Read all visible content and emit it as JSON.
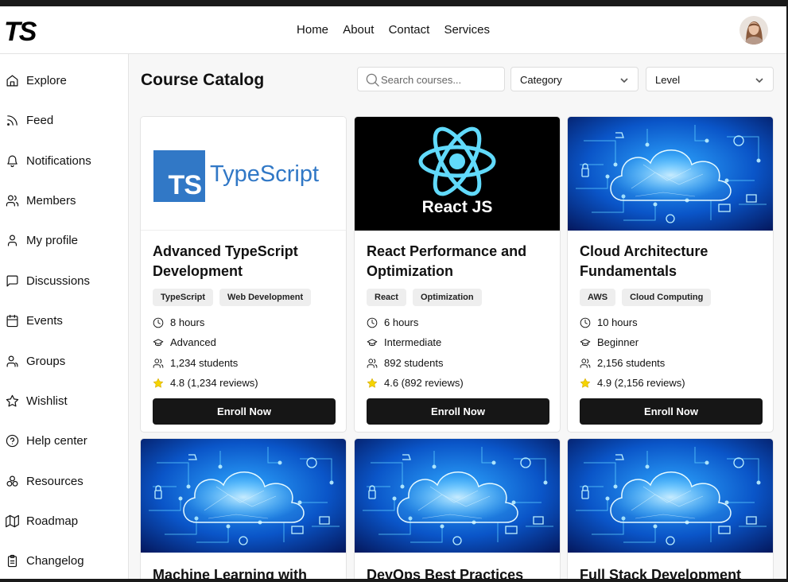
{
  "header": {
    "logo_text": "TS",
    "nav": [
      "Home",
      "About",
      "Contact",
      "Services"
    ]
  },
  "sidebar": {
    "items": [
      {
        "label": "Explore",
        "icon": "home-icon"
      },
      {
        "label": "Feed",
        "icon": "rss-icon"
      },
      {
        "label": "Notifications",
        "icon": "bell-icon"
      },
      {
        "label": "Members",
        "icon": "users-icon"
      },
      {
        "label": "My profile",
        "icon": "user-icon"
      },
      {
        "label": "Discussions",
        "icon": "message-square-icon"
      },
      {
        "label": "Events",
        "icon": "calendar-icon"
      },
      {
        "label": "Groups",
        "icon": "group-icon"
      },
      {
        "label": "Wishlist",
        "icon": "star-icon"
      },
      {
        "label": "Help center",
        "icon": "help-circle-icon"
      },
      {
        "label": "Resources",
        "icon": "resources-icon"
      },
      {
        "label": "Roadmap",
        "icon": "map-icon"
      },
      {
        "label": "Changelog",
        "icon": "clipboard-icon"
      }
    ]
  },
  "main": {
    "title": "Course Catalog",
    "search_placeholder": "Search courses...",
    "category_label": "Category",
    "level_label": "Level",
    "enroll_label": "Enroll Now",
    "courses": [
      {
        "title": "Advanced TypeScript Development",
        "image": "typescript",
        "image_text": "TypeScript",
        "image_badge": "TS",
        "tags": [
          "TypeScript",
          "Web Development"
        ],
        "duration": "8 hours",
        "level": "Advanced",
        "students": "1,234 students",
        "rating": "4.8 (1,234 reviews)"
      },
      {
        "title": "React Performance and Optimization",
        "image": "react",
        "image_text": "React JS",
        "tags": [
          "React",
          "Optimization"
        ],
        "duration": "6 hours",
        "level": "Intermediate",
        "students": "892 students",
        "rating": "4.6 (892 reviews)"
      },
      {
        "title": "Cloud Architecture Fundamentals",
        "image": "cloud",
        "tags": [
          "AWS",
          "Cloud Computing"
        ],
        "duration": "10 hours",
        "level": "Beginner",
        "students": "2,156 students",
        "rating": "4.9 (2,156 reviews)"
      },
      {
        "title": "Machine Learning with",
        "image": "cloud"
      },
      {
        "title": "DevOps Best Practices",
        "image": "cloud"
      },
      {
        "title": "Full Stack Development",
        "image": "cloud"
      }
    ]
  },
  "colors": {
    "button_bg": "#161616",
    "ts_blue": "#3178c6",
    "react_cyan": "#61dafb",
    "star": "#f5d400"
  }
}
